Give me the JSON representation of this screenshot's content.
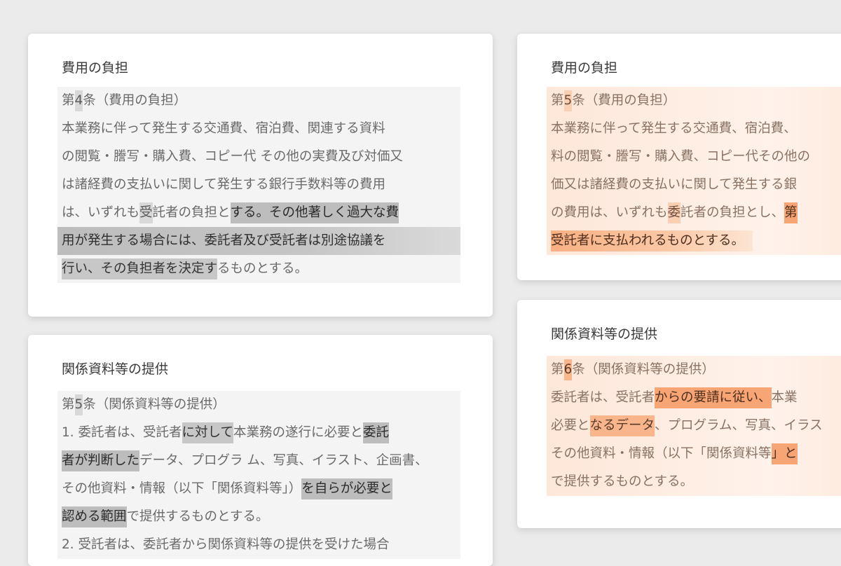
{
  "cards": {
    "left_top": {
      "title": "費用の負担",
      "heading": {
        "pre": "第",
        "num": "4",
        "post": "条（費用の負担）"
      },
      "lines": [
        "本業務に伴って発生する交通費、宿泊費、関連する資料",
        "の閲覧・謄写・購入費、コピー代 その他の実費及び対価又",
        "は諸経費の支払いに関して発生する銀行手数料等の費用",
        {
          "a": "は、いずれも",
          "b": "受",
          "c": "託者の負担と",
          "d": "する。その他著しく過大な費"
        },
        "用が発生する場合には、委託者及び受託者は別途協議を",
        {
          "a": "行い、その負担者を決定す",
          "b": "るものとする。"
        }
      ]
    },
    "left_bottom": {
      "title": "関係資料等の提供",
      "heading": {
        "pre": "第",
        "num": "5",
        "post": "条（関係資料等の提供）"
      },
      "lines": [
        {
          "a": "1. 委託者は、受託者",
          "b": "に対して",
          "c": "本業務の遂行に必要と",
          "d": "委託"
        },
        {
          "a": "者が判断した",
          "b": "データ、プログラ ム、写真、イラスト、企画書、"
        },
        {
          "a": "その他資料・情報（以下「関係資料等」）",
          "b": "を自らが必要と"
        },
        {
          "a": "認める範囲",
          "b": "で提供するものとする。"
        },
        "2. 受託者は、委託者から関係資料等の提供を受けた場合"
      ]
    },
    "right_top": {
      "title": "費用の負担",
      "heading": {
        "pre": "第",
        "num": "5",
        "post": "条（費用の負担）"
      },
      "lines": [
        "本業務に伴って発生する交通費、宿泊費、",
        "料の閲覧・謄写・購入費、コピー代その他の",
        "価又は諸経費の支払いに関して発生する銀",
        {
          "a": "の費用は、いずれも",
          "b": "委",
          "c": "託者の負担とし、",
          "d": "第"
        },
        "受託者に支払われるものとする。"
      ]
    },
    "right_bottom": {
      "title": "関係資料等の提供",
      "heading": {
        "pre": "第",
        "num": "6",
        "post": "条（関係資料等の提供）"
      },
      "lines": [
        {
          "a": "委託者は、受託者",
          "b": "からの要請に従い、",
          "c": "本業"
        },
        {
          "a": "必要と",
          "b": "なるデータ",
          "c": "、プログラム、写真、イラス"
        },
        {
          "a": "その他資料・情報（以下「関係資料等",
          "b": "」と"
        },
        "で提供するものとする。"
      ]
    }
  }
}
